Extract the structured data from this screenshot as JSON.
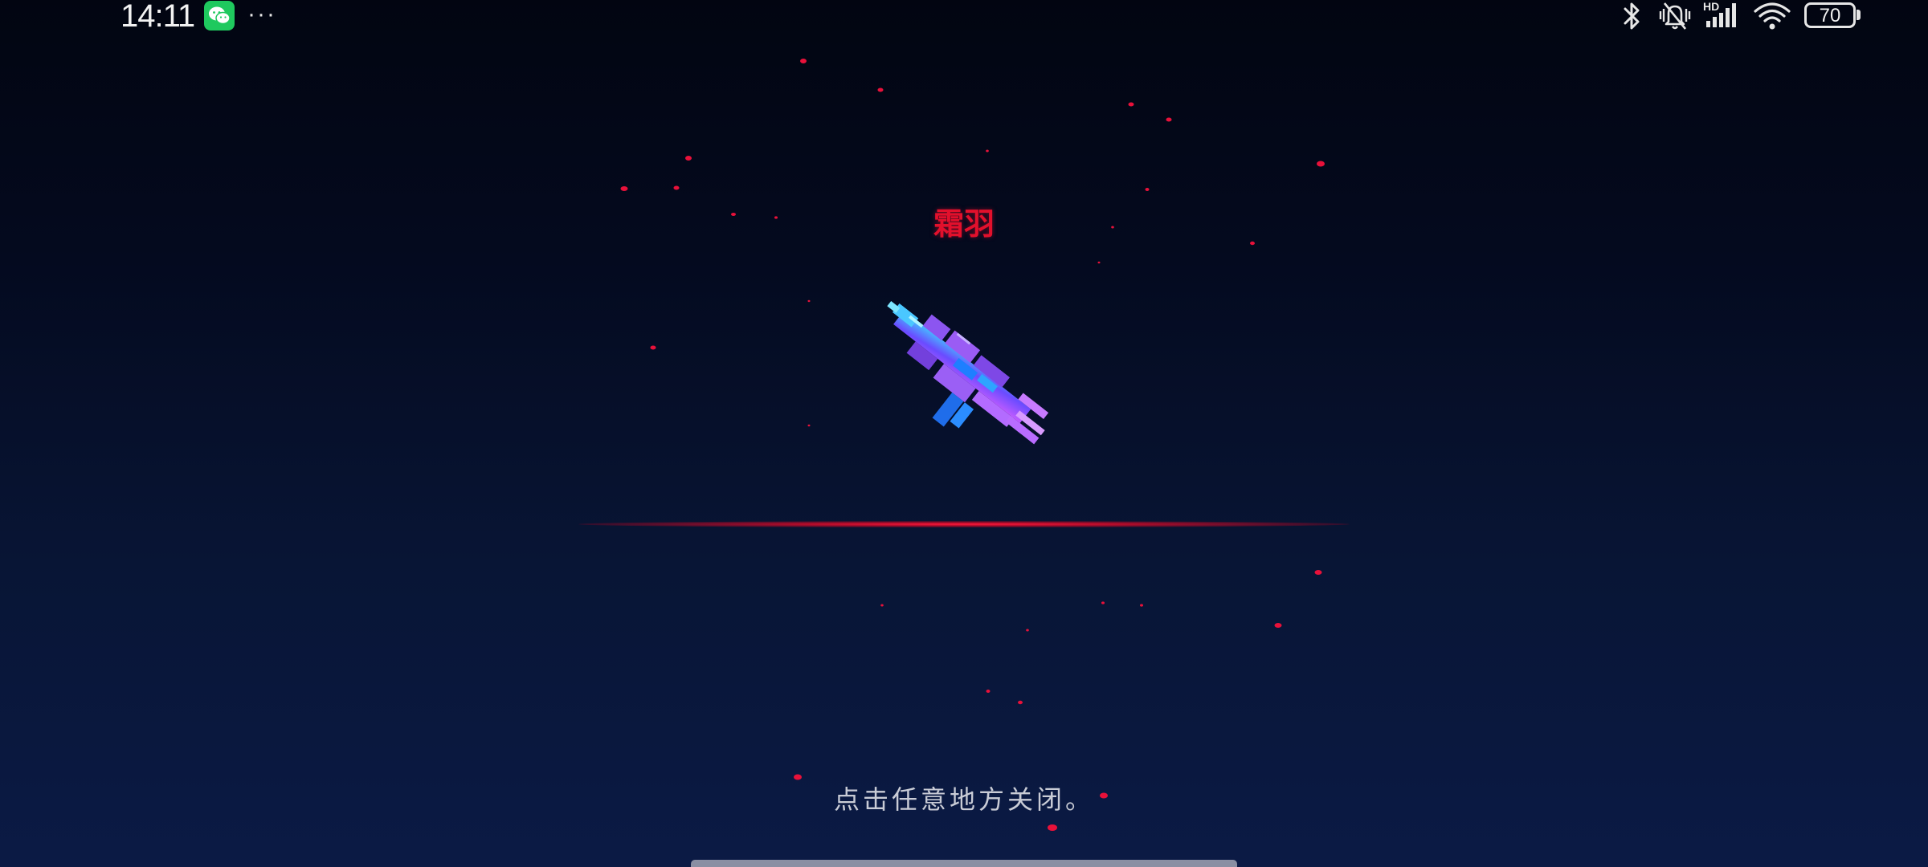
{
  "status_bar": {
    "time": "14:11",
    "notification_app": "wechat-icon",
    "more": "···",
    "hd_label": "HD",
    "battery_level": "70",
    "icons": [
      "bluetooth-icon",
      "mute-vibrate-icon",
      "signal-icon",
      "wifi-icon",
      "battery-icon"
    ]
  },
  "reward": {
    "item_name": "霜羽",
    "item_name_color": "#e2102c",
    "item_image": "voxel-crossbow-weapon-icon"
  },
  "hint": {
    "close_text": "点击任意地方关闭。"
  },
  "colors": {
    "background_top": "#020511",
    "background_bottom": "#0b1a45",
    "accent_red": "#e2102c"
  }
}
